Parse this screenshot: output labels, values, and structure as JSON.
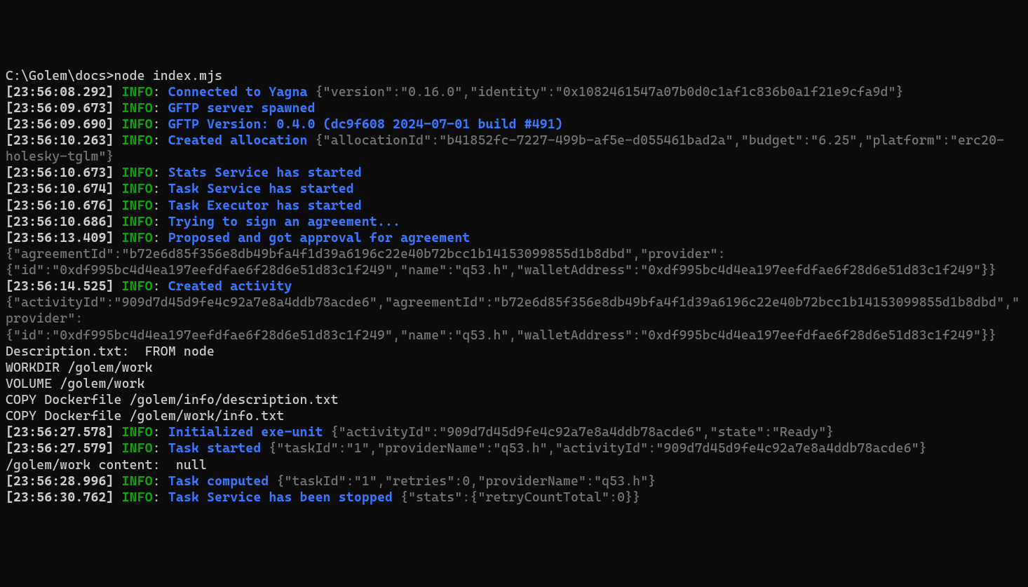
{
  "prompt": "C:\\Golem\\docs>node index.mjs",
  "lines": [
    {
      "ts": "[23:56:08.292]",
      "level": "INFO",
      "msg": "Connected to Yagna",
      "json": " {\"version\":\"0.16.0\",\"identity\":\"0x1082461547a07b0d0c1af1c836b0a1f21e9cfa9d\"}"
    },
    {
      "ts": "[23:56:09.673]",
      "level": "INFO",
      "msg": "GFTP server spawned",
      "json": ""
    },
    {
      "ts": "[23:56:09.690]",
      "level": "INFO",
      "msg": "GFTP Version: 0.4.0 (dc9f608 2024-07-01 build #491)",
      "json": ""
    },
    {
      "ts": "[23:56:10.263]",
      "level": "INFO",
      "msg": "Created allocation",
      "json": " {\"allocationId\":\"b41852fc-7227-499b-af5e-d055461bad2a\",\"budget\":\"6.25\",\"platform\":\"erc20-holesky-tglm\"}"
    },
    {
      "ts": "[23:56:10.673]",
      "level": "INFO",
      "msg": "Stats Service has started",
      "json": ""
    },
    {
      "ts": "[23:56:10.674]",
      "level": "INFO",
      "msg": "Task Service has started",
      "json": ""
    },
    {
      "ts": "[23:56:10.676]",
      "level": "INFO",
      "msg": "Task Executor has started",
      "json": ""
    },
    {
      "ts": "[23:56:10.686]",
      "level": "INFO",
      "msg": "Trying to sign an agreement...",
      "json": ""
    },
    {
      "ts": "[23:56:13.409]",
      "level": "INFO",
      "msg": "Proposed and got approval for agreement",
      "json": " {\"agreementId\":\"b72e6d85f356e8db49bfa4f1d39a6196c22e40b72bcc1b14153099855d1b8dbd\",\"provider\":{\"id\":\"0xdf995bc4d4ea197eefdfae6f28d6e51d83c1f249\",\"name\":\"q53.h\",\"walletAddress\":\"0xdf995bc4d4ea197eefdfae6f28d6e51d83c1f249\"}}"
    },
    {
      "ts": "[23:56:14.525]",
      "level": "INFO",
      "msg": "Created activity",
      "json": " {\"activityId\":\"909d7d45d9fe4c92a7e8a4ddb78acde6\",\"agreementId\":\"b72e6d85f356e8db49bfa4f1d39a6196c22e40b72bcc1b14153099855d1b8dbd\",\"provider\":{\"id\":\"0xdf995bc4d4ea197eefdfae6f28d6e51d83c1f249\",\"name\":\"q53.h\",\"walletAddress\":\"0xdf995bc4d4ea197eefdfae6f28d6e51d83c1f249\"}}"
    }
  ],
  "plaintext": [
    "Description.txt:  FROM node",
    "WORKDIR /golem/work",
    "VOLUME /golem/work",
    "COPY Dockerfile /golem/info/description.txt",
    "COPY Dockerfile /golem/work/info.txt",
    ""
  ],
  "lines2": [
    {
      "ts": "[23:56:27.578]",
      "level": "INFO",
      "msg": "Initialized exe-unit",
      "json": " {\"activityId\":\"909d7d45d9fe4c92a7e8a4ddb78acde6\",\"state\":\"Ready\"}"
    },
    {
      "ts": "[23:56:27.579]",
      "level": "INFO",
      "msg": "Task started",
      "json": " {\"taskId\":\"1\",\"providerName\":\"q53.h\",\"activityId\":\"909d7d45d9fe4c92a7e8a4ddb78acde6\"}"
    }
  ],
  "plaintext2": [
    "/golem/work content:  null"
  ],
  "lines3": [
    {
      "ts": "[23:56:28.996]",
      "level": "INFO",
      "msg": "Task computed",
      "json": " {\"taskId\":\"1\",\"retries\":0,\"providerName\":\"q53.h\"}"
    },
    {
      "ts": "[23:56:30.762]",
      "level": "INFO",
      "msg": "Task Service has been stopped",
      "json": " {\"stats\":{\"retryCountTotal\":0}}"
    }
  ]
}
